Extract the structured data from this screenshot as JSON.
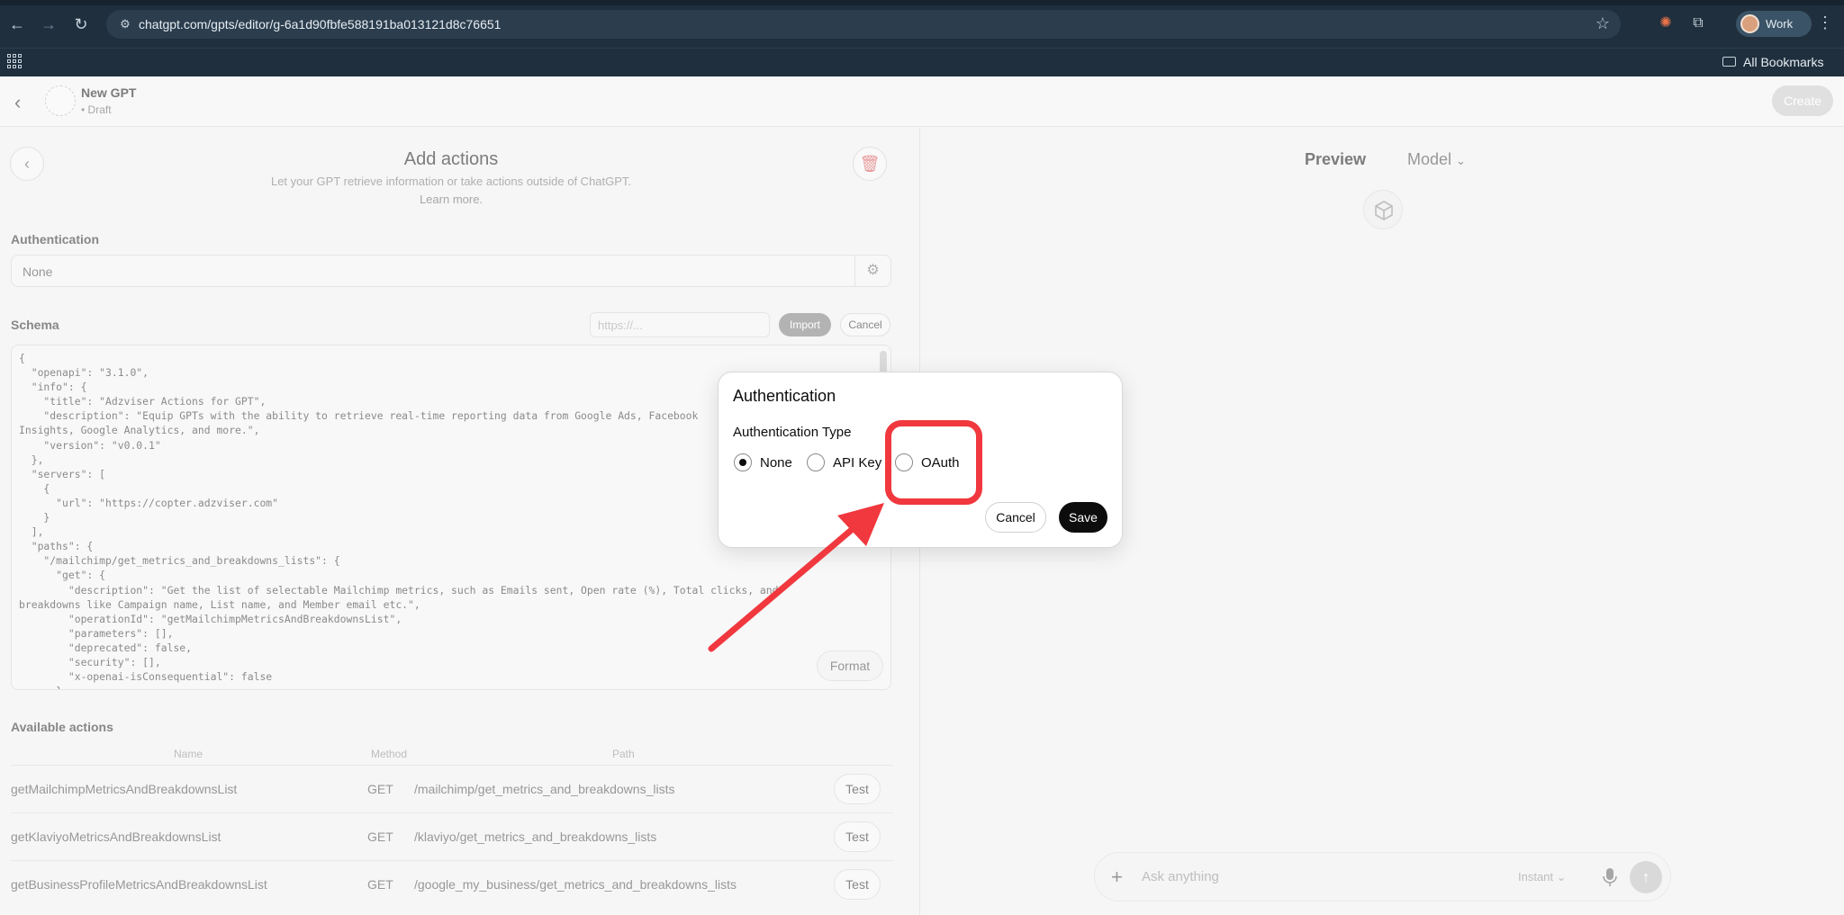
{
  "browser": {
    "url": "chatgpt.com/gpts/editor/g-6a1d90fbfe588191ba013121d8c76651",
    "profile_label": "Work",
    "bookmarks_label": "All Bookmarks"
  },
  "header": {
    "gpt_name": "New GPT",
    "gpt_status": "• Draft",
    "create_label": "Create"
  },
  "actions_panel": {
    "title": "Add actions",
    "subtitle": "Let your GPT retrieve information or take actions outside of ChatGPT.",
    "learn_more": "Learn more.",
    "authentication_label": "Authentication",
    "authentication_value": "None",
    "schema_label": "Schema",
    "url_placeholder": "https://...",
    "import_label": "Import",
    "cancel_label": "Cancel",
    "schema_text": "{\n  \"openapi\": \"3.1.0\",\n  \"info\": {\n    \"title\": \"Adzviser Actions for GPT\",\n    \"description\": \"Equip GPTs with the ability to retrieve real-time reporting data from Google Ads, Facebook\nInsights, Google Analytics, and more.\",\n    \"version\": \"v0.0.1\"\n  },\n  \"servers\": [\n    {\n      \"url\": \"https://copter.adzviser.com\"\n    }\n  ],\n  \"paths\": {\n    \"/mailchimp/get_metrics_and_breakdowns_lists\": {\n      \"get\": {\n        \"description\": \"Get the list of selectable Mailchimp metrics, such as Emails sent, Open rate (%), Total clicks, and\nbreakdowns like Campaign name, List name, and Member email etc.\",\n        \"operationId\": \"getMailchimpMetricsAndBreakdownsList\",\n        \"parameters\": [],\n        \"deprecated\": false,\n        \"security\": [],\n        \"x-openai-isConsequential\": false\n      }",
    "format_label": "Format",
    "available_actions_label": "Available actions",
    "table_headers": {
      "name": "Name",
      "method": "Method",
      "path": "Path"
    },
    "actions": [
      {
        "name": "getMailchimpMetricsAndBreakdownsList",
        "method": "GET",
        "path": "/mailchimp/get_metrics_and_breakdowns_lists",
        "button": "Test"
      },
      {
        "name": "getKlaviyoMetricsAndBreakdownsList",
        "method": "GET",
        "path": "/klaviyo/get_metrics_and_breakdowns_lists",
        "button": "Test"
      },
      {
        "name": "getBusinessProfileMetricsAndBreakdownsList",
        "method": "GET",
        "path": "/google_my_business/get_metrics_and_breakdowns_lists",
        "button": "Test"
      }
    ]
  },
  "preview_panel": {
    "preview_tab": "Preview",
    "model_tab": "Model",
    "composer_placeholder": "Ask anything",
    "mode_label": "Instant"
  },
  "auth_modal": {
    "title": "Authentication",
    "type_label": "Authentication Type",
    "options": [
      {
        "label": "None",
        "selected": true
      },
      {
        "label": "API Key",
        "selected": false
      },
      {
        "label": "OAuth",
        "selected": false
      }
    ],
    "cancel_label": "Cancel",
    "save_label": "Save"
  },
  "annotation": {
    "color": "#f0383e"
  }
}
